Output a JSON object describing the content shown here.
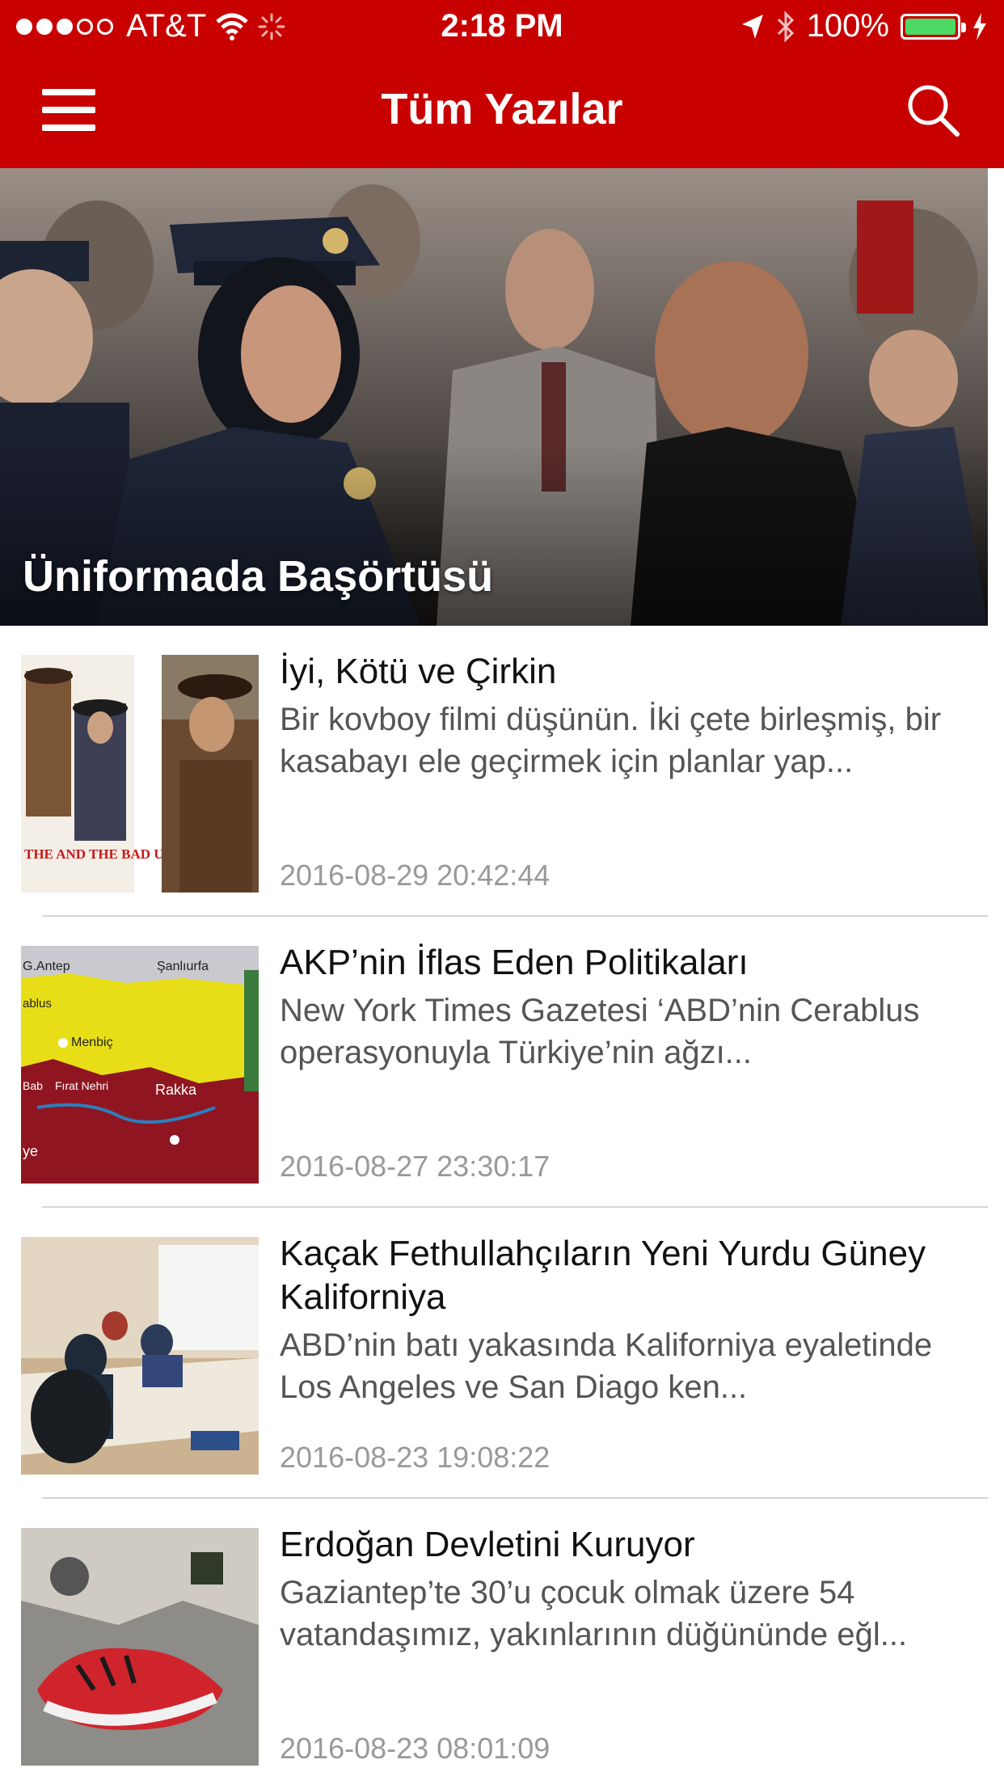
{
  "status_bar": {
    "carrier": "AT&T",
    "time": "2:18 PM",
    "battery": "100%",
    "battery_level": 1.0
  },
  "nav": {
    "title": "Tüm Yazılar"
  },
  "hero": {
    "title": "Üniformada Başörtüsü"
  },
  "articles": [
    {
      "title": "İyi, Kötü ve Çirkin",
      "snippet": "Bir kovboy filmi düşünün. İki çete birleşmiş, bir kasabayı ele geçirmek için planlar yap...",
      "date": "2016-08-29 20:42:44",
      "thumb_caption": "THE AND THE BAD UGLY"
    },
    {
      "title": "AKP’nin İflas Eden Politikaları",
      "snippet": "New York Times Gazetesi ‘ABD’nin Cerablus operasyonuyla Türkiye’nin ağzı...",
      "date": "2016-08-27 23:30:17",
      "map_labels": [
        "G.Antep",
        "Şanlıurfa",
        "ablus",
        "Menbiç",
        "Fırat Nehri",
        "Bab",
        "Rakka",
        "ye"
      ]
    },
    {
      "title": "Kaçak Fethullahçıların Yeni Yurdu Güney Kaliforniya",
      "snippet": "ABD’nin batı yakasında Kaliforniya eyaletinde Los Angeles ve San Diago ken...",
      "date": "2016-08-23 19:08:22"
    },
    {
      "title": "Erdoğan Devletini Kuruyor",
      "snippet": "Gaziantep’te 30’u çocuk olmak üzere 54 vatandaşımız, yakınlarının düğününde eğl...",
      "date": "2016-08-23 08:01:09"
    }
  ],
  "colors": {
    "brand_red": "#c80000",
    "battery_green": "#4cd964"
  }
}
